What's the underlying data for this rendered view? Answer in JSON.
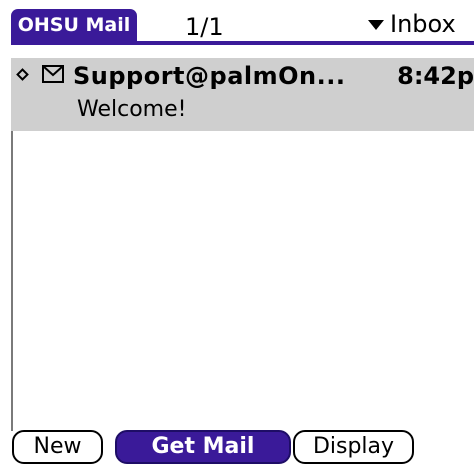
{
  "titlebar": {
    "app_name": "OHSU Mail",
    "counter": "1/1",
    "folder": "Inbox"
  },
  "messages": [
    {
      "sender": "Support@palmOn...",
      "time": "8:42p",
      "subject": "Welcome!",
      "selected": true
    }
  ],
  "buttons": {
    "new": "New",
    "get_mail": "Get Mail",
    "display": "Display"
  },
  "colors": {
    "accent": "#3a1a99",
    "selected_row": "#cfcfcf"
  },
  "icons": {
    "unread": "diamond-icon",
    "message": "envelope-icon",
    "folder_dropdown": "triangle-down-icon"
  }
}
